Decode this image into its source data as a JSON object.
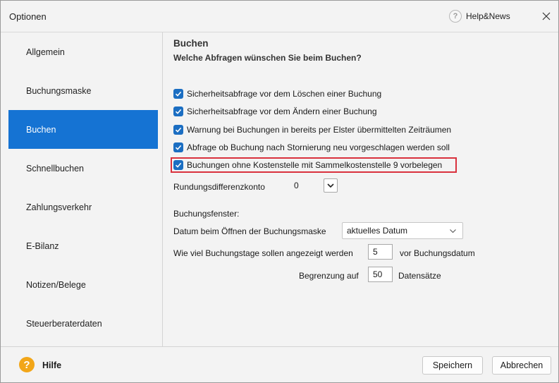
{
  "window": {
    "title": "Optionen",
    "help_label": "Help&News",
    "help_icon": "?",
    "close_label": "×"
  },
  "sidebar": {
    "items": [
      {
        "label": "Allgemein",
        "active": false
      },
      {
        "label": "Buchungsmaske",
        "active": false
      },
      {
        "label": "Buchen",
        "active": true
      },
      {
        "label": "Schnellbuchen",
        "active": false
      },
      {
        "label": "Zahlungsverkehr",
        "active": false
      },
      {
        "label": "E-Bilanz",
        "active": false
      },
      {
        "label": "Notizen/Belege",
        "active": false
      },
      {
        "label": "Steuerberaterdaten",
        "active": false
      }
    ]
  },
  "main": {
    "title": "Buchen",
    "subtitle": "Welche Abfragen wünschen Sie beim Buchen?",
    "checkboxes": [
      {
        "label": "Sicherheitsabfrage vor dem Löschen einer Buchung",
        "checked": true
      },
      {
        "label": "Sicherheitsabfrage vor dem Ändern einer Buchung",
        "checked": true
      },
      {
        "label": "Warnung bei Buchungen in bereits per Elster übermittelten Zeiträumen",
        "checked": true
      },
      {
        "label": "Abfrage ob Buchung nach Stornierung neu vorgeschlagen werden soll",
        "checked": true
      },
      {
        "label": "Buchungen ohne Kostenstelle mit Sammelkostenstelle 9 vorbelegen",
        "checked": true,
        "highlighted": true
      }
    ],
    "rounding": {
      "label": "Rundungsdifferenzkonto",
      "value": "0"
    },
    "booking_window": {
      "heading": "Buchungsfenster:",
      "date_label": "Datum beim Öffnen der Buchungsmaske",
      "date_value": "aktuelles Datum",
      "days_label": "Wie viel Buchungstage sollen angezeigt werden",
      "days_value": "5",
      "days_suffix": "vor Buchungsdatum",
      "limit_label": "Begrenzung auf",
      "limit_value": "50",
      "limit_suffix": "Datensätze"
    }
  },
  "footer": {
    "help_icon": "?",
    "help_label": "Hilfe",
    "save_label": "Speichern",
    "cancel_label": "Abbrechen"
  },
  "colors": {
    "accent": "#1573d3",
    "checkbox": "#1b6ec2",
    "highlight_border": "#d9313d",
    "help_icon": "#f2a618"
  },
  "icons": {
    "help": "question-circle-icon",
    "close": "close-icon",
    "checkbox": "checkmark-icon",
    "dropdown": "chevron-down-icon",
    "footer_help": "question-circle-icon"
  }
}
